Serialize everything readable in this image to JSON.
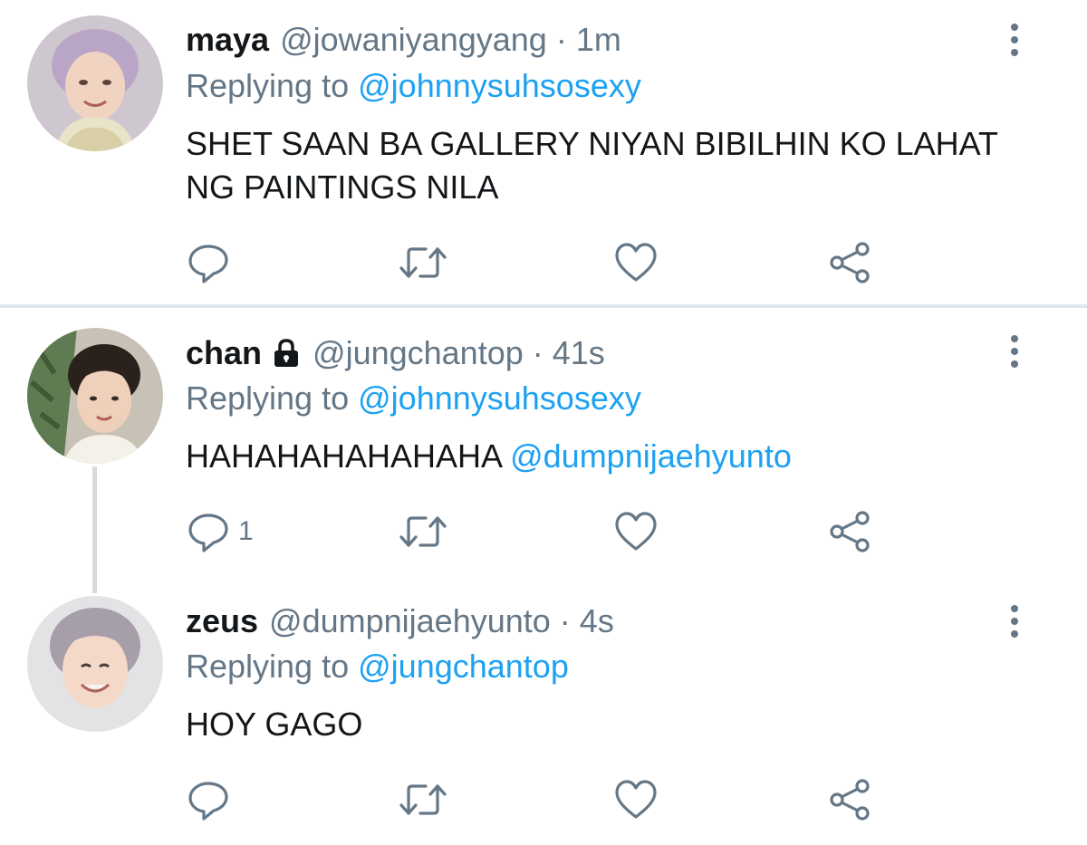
{
  "tweets": [
    {
      "name": "maya",
      "handle": "@jowaniyangyang",
      "time": "1m",
      "replying_prefix": "Replying to",
      "replying_to": "@johnnysuhsosexy",
      "text": "SHET SAAN BA GALLERY NIYAN BIBILHIN KO LAHAT NG PAINTINGS NILA",
      "reply_count": "",
      "locked": false
    },
    {
      "name": "chan",
      "handle": "@jungchantop",
      "time": "41s",
      "replying_prefix": "Replying to",
      "replying_to": "@johnnysuhsosexy",
      "text": "HAHAHAHAHAHAHA",
      "text_mention": "@dumpnijaehyunto",
      "reply_count": "1",
      "locked": true
    },
    {
      "name": "zeus",
      "handle": "@dumpnijaehyunto",
      "time": "4s",
      "replying_prefix": "Replying to",
      "replying_to": "@jungchantop",
      "text": "HOY GAGO",
      "reply_count": "",
      "locked": false
    }
  ],
  "separator": "·",
  "colors": {
    "link": "#1da1f2",
    "secondary": "#657786",
    "icon": "#657786",
    "divider": "#e1e8ed"
  },
  "icons": {
    "reply": "reply-icon",
    "retweet": "retweet-icon",
    "like": "heart-icon",
    "share": "share-icon",
    "more": "more-vertical-icon",
    "lock": "lock-icon"
  }
}
